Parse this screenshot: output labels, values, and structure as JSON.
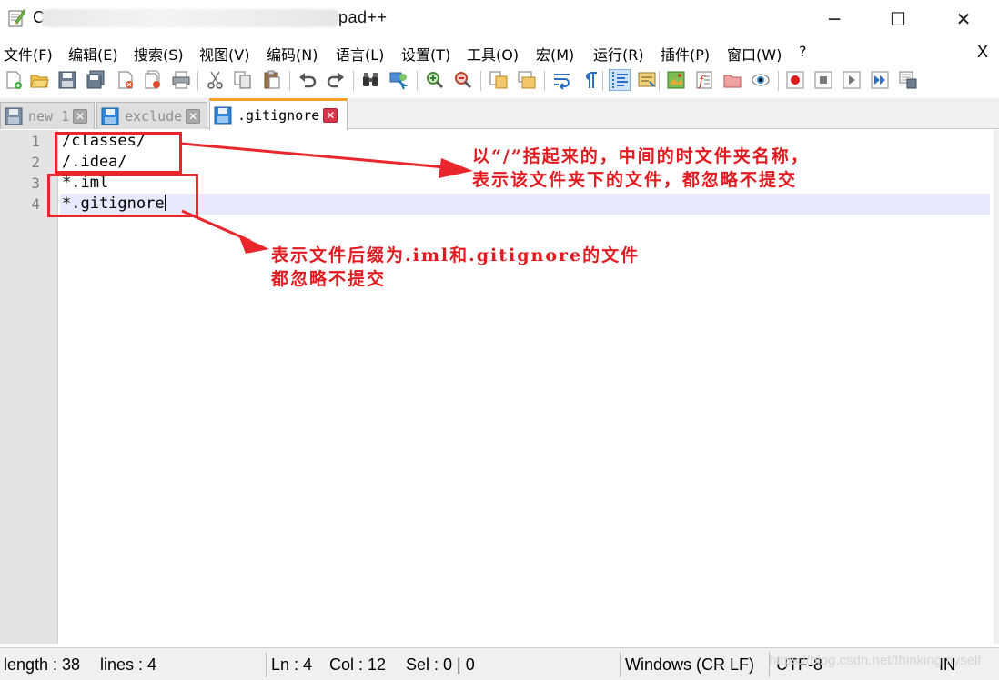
{
  "window": {
    "title_visible": "C",
    "title_suffix": "pad++",
    "minimize_glyph": "─",
    "maximize_glyph": "☐",
    "close_glyph": "✕"
  },
  "menu": {
    "items": [
      "文件(F)",
      "编辑(E)",
      "搜索(S)",
      "视图(V)",
      "编码(N)",
      "语言(L)",
      "设置(T)",
      "工具(O)",
      "宏(M)",
      "运行(R)",
      "插件(P)",
      "窗口(W)",
      "?"
    ],
    "close_label": "X"
  },
  "toolbar": {
    "icons": [
      "new-file-icon",
      "open-file-icon",
      "save-icon",
      "save-all-icon",
      "close-icon",
      "close-all-icon",
      "print-icon",
      "cut-icon",
      "copy-icon",
      "paste-icon",
      "undo-icon",
      "redo-icon",
      "find-icon",
      "replace-icon",
      "zoom-in-icon",
      "zoom-out-icon",
      "sync-vertical-icon",
      "sync-horizontal-icon",
      "word-wrap-icon",
      "show-all-chars-icon",
      "indent-guide-icon",
      "user-defined-language-icon",
      "document-map-icon",
      "function-list-icon",
      "folder-workspace-icon",
      "monitoring-icon",
      "record-macro-icon",
      "stop-recording-icon",
      "playback-macro-icon",
      "run-macro-multiple-icon",
      "save-macro-icon"
    ],
    "colors": {
      "record": "#d91c1c",
      "accent": "#2b6cc4"
    }
  },
  "tabs": [
    {
      "label": "new 1",
      "active": false
    },
    {
      "label": "exclude",
      "active": false
    },
    {
      "label": ".gitignore",
      "active": true
    }
  ],
  "editor": {
    "lines": [
      {
        "number": "1",
        "text": "/classes/"
      },
      {
        "number": "2",
        "text": "/.idea/"
      },
      {
        "number": "3",
        "text": "*.iml"
      },
      {
        "number": "4",
        "text": "*.gitignore"
      }
    ],
    "current_line": 4
  },
  "annotations": {
    "note1_line1": "以“/”括起来的，中间的时文件夹名称，",
    "note1_line2": "表示该文件夹下的文件，都忽略不提交",
    "note2_line1": "表示文件后缀为.iml和.gitignore的文件",
    "note2_line2": "都忽略不提交",
    "color": "#e11a20"
  },
  "status": {
    "length": "length : 38",
    "lines": "lines : 4",
    "ln": "Ln : 4",
    "col": "Col : 12",
    "sel": "Sel : 0 | 0",
    "eol": "Windows (CR LF)",
    "encoding": "UTF-8",
    "mode": "IN",
    "watermark": "https://blog.csdn.net/thinkingmyself"
  }
}
